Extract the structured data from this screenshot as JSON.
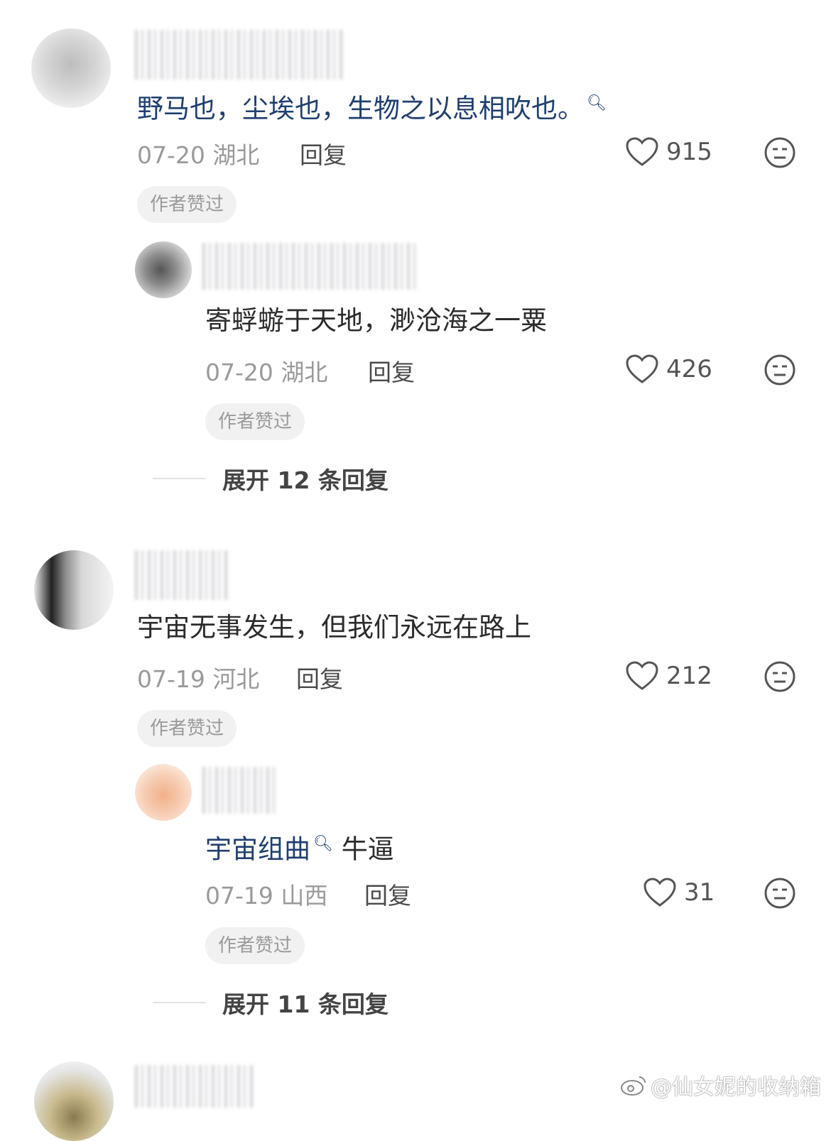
{
  "comments": [
    {
      "text": "野马也，尘埃也，生物之以息相吹也。",
      "date": "07-20",
      "location": "湖北",
      "reply_label": "回复",
      "likes": "915",
      "badge": "作者赞过",
      "replies": [
        {
          "text": "寄蜉蝣于天地，渺沧海之一粟",
          "date": "07-20",
          "location": "湖北",
          "reply_label": "回复",
          "likes": "426",
          "badge": "作者赞过"
        }
      ],
      "expand_label": "展开 12 条回复"
    },
    {
      "text": "宇宙无事发生，但我们永远在路上",
      "date": "07-19",
      "location": "河北",
      "reply_label": "回复",
      "likes": "212",
      "badge": "作者赞过",
      "replies": [
        {
          "link_text": "宇宙组曲",
          "text": "牛逼",
          "date": "07-19",
          "location": "山西",
          "reply_label": "回复",
          "likes": "31",
          "badge": "作者赞过"
        }
      ],
      "expand_label": "展开 11 条回复"
    }
  ],
  "watermark": "@仙女妮的收纳箱",
  "icons": {
    "like": "heart-outline-icon",
    "dislike": "neutral-face-icon",
    "search": "search-icon",
    "weibo": "weibo-logo-icon"
  },
  "colors": {
    "link_text": "#1f3f6e",
    "meta_text": "#9a9a9a",
    "badge_bg": "#f1f1f1"
  }
}
